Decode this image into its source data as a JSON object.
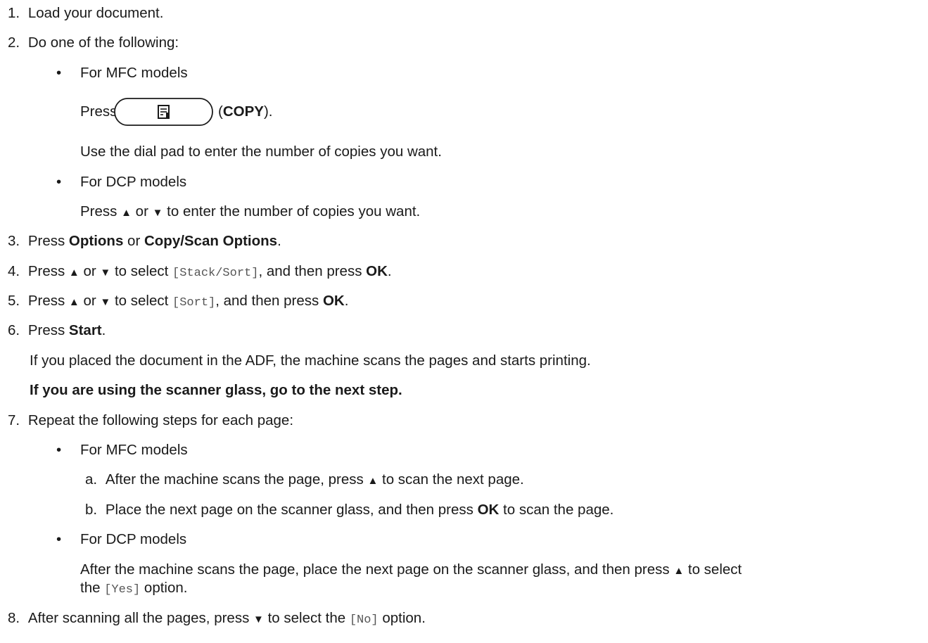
{
  "steps": {
    "s1": {
      "num": "1.",
      "text": "Load your document."
    },
    "s2": {
      "num": "2.",
      "text": "Do one of the following:",
      "mfc": {
        "bullet": "•",
        "heading": "For MFC models",
        "press": "Press",
        "copy_paren_open": "(",
        "copy_label": "COPY",
        "copy_paren_close": ").",
        "dialpad": "Use the dial pad to enter the number of copies you want."
      },
      "dcp": {
        "bullet": "•",
        "heading": "For DCP models",
        "press": "Press",
        "up": "▲",
        "or": " or ",
        "down": "▼",
        "rest": " to enter the number of copies you want."
      }
    },
    "s3": {
      "num": "3.",
      "press": "Press ",
      "options": "Options",
      "or": " or ",
      "copyscan": "Copy/Scan Options",
      "end": "."
    },
    "s4": {
      "num": "4.",
      "press": "Press ",
      "up": "▲",
      "or": " or ",
      "down": "▼",
      "toselect": " to select ",
      "code": "[Stack/Sort]",
      "then": ", and then press ",
      "ok": "OK",
      "end": "."
    },
    "s5": {
      "num": "5.",
      "press": "Press ",
      "up": "▲",
      "or": " or ",
      "down": "▼",
      "toselect": " to select ",
      "code": "[Sort]",
      "then": ", and then press ",
      "ok": "OK",
      "end": "."
    },
    "s6": {
      "num": "6.",
      "press": "Press ",
      "start": "Start",
      "end": ".",
      "adf": "If you placed the document in the ADF, the machine scans the pages and starts printing.",
      "glass": "If you are using the scanner glass, go to the next step."
    },
    "s7": {
      "num": "7.",
      "text": "Repeat the following steps for each page:",
      "mfc": {
        "bullet": "•",
        "heading": "For MFC models",
        "a_num": "a.",
        "a_pre": "After the machine scans the page, press ",
        "a_up": "▲",
        "a_post": " to scan the next page.",
        "b_num": "b.",
        "b_pre": "Place the next page on the scanner glass, and then press ",
        "b_ok": "OK",
        "b_post": " to scan the page."
      },
      "dcp": {
        "bullet": "•",
        "heading": "For DCP models",
        "l1_pre": "After the machine scans the page, place the next page on the scanner glass, and then press ",
        "l1_up": "▲",
        "l1_post": " to select",
        "l2_pre": "the ",
        "l2_code": "[Yes]",
        "l2_post": " option."
      }
    },
    "s8": {
      "num": "8.",
      "pre": "After scanning all the pages, press ",
      "down": "▼",
      "toselect": " to select the ",
      "code": "[No]",
      "post": " option."
    }
  },
  "icons": {
    "copy": "copy-document-icon",
    "up": "up-arrow-icon",
    "down": "down-arrow-icon"
  }
}
